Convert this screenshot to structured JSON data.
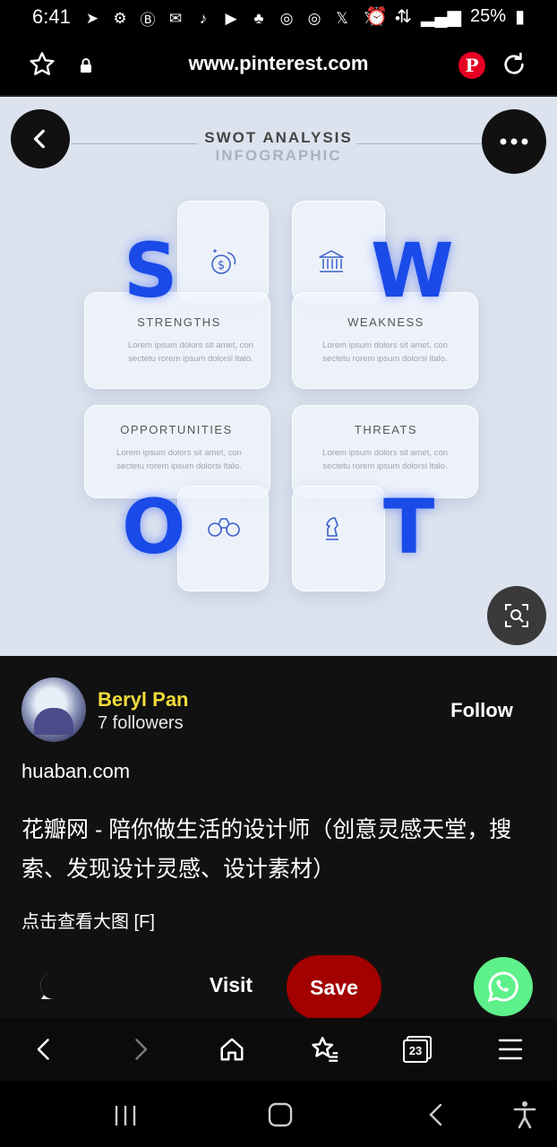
{
  "status_bar": {
    "time": "6:41",
    "battery": "25%",
    "notification_icons": [
      "telegram-icon",
      "gear-icon",
      "b-icon",
      "chat-icon",
      "tiktok-icon",
      "youtube-icon",
      "dots-icon",
      "instagram-icon",
      "instagram-icon",
      "x-icon",
      "x-icon"
    ],
    "dot": "•"
  },
  "browser": {
    "url": "www.pinterest.com"
  },
  "pin_image": {
    "title": "SWOT ANALYSIS",
    "subtitle": "INFOGRAPHIC",
    "cards": [
      {
        "letter": "S",
        "label": "STRENGTHS",
        "text1": "Lorem ipsum dolors sit amet, con",
        "text2": "sectetu rorem ipsum dolorsi ltalo."
      },
      {
        "letter": "W",
        "label": "WEAKNESS",
        "text1": "Lorem ipsum dolors sit amet, con",
        "text2": "sectetu rorem ipsum dolorsi ltalo."
      },
      {
        "letter": "O",
        "label": "OPPORTUNITIES",
        "text1": "Lorem ipsum dolors sit amet, con",
        "text2": "sectetu rorem ipsum dolorsi ltalo."
      },
      {
        "letter": "T",
        "label": "THREATS",
        "text1": "Lorem ipsum dolors sit amet, con",
        "text2": "sectetu rorem ipsum dolorsi ltalo."
      }
    ]
  },
  "profile": {
    "name": "Beryl Pan",
    "followers": "7 followers",
    "follow_label": "Follow",
    "source": "huaban.com",
    "title": "花瓣网 - 陪你做生活的设计师（创意灵感天堂，搜索、发现设计灵感、设计素材）",
    "description": "点击查看大图 [F]"
  },
  "actions": {
    "visit_label": "Visit",
    "save_label": "Save",
    "save_color": "#a30000",
    "whatsapp_color": "#5ef08a"
  },
  "browser_nav": {
    "tabs_count": "23"
  },
  "colors": {
    "accent_blue": "#1a4be8",
    "name_yellow": "#f2dc3a"
  }
}
